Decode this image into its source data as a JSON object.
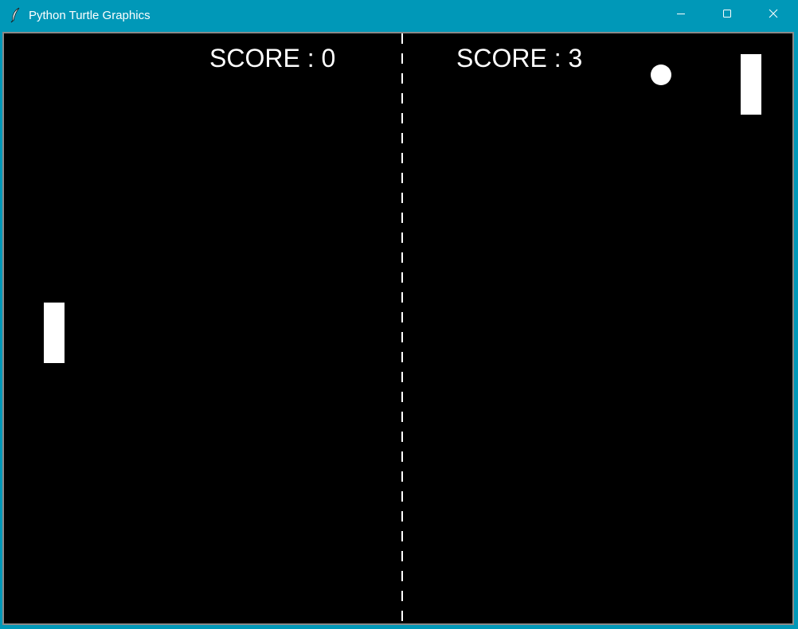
{
  "window": {
    "title": "Python Turtle Graphics",
    "titlebar_color": "#0098b8",
    "icons": {
      "app": "feather-icon",
      "minimize": "minimize-icon",
      "maximize": "maximize-icon",
      "close": "close-icon"
    }
  },
  "game": {
    "background_color": "#000000",
    "foreground_color": "#ffffff",
    "score_left": "SCORE : 0",
    "score_right": "SCORE : 3"
  }
}
